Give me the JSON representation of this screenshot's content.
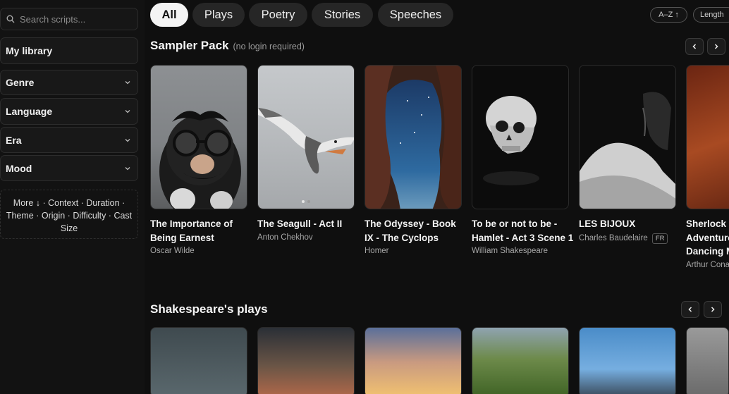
{
  "sidebar": {
    "search_placeholder": "Search scripts...",
    "my_library": "My library",
    "filters": [
      "Genre",
      "Language",
      "Era",
      "Mood"
    ],
    "more_label": "More ↓",
    "more_items": [
      "Context",
      "Duration",
      "Theme",
      "Origin",
      "Difficulty",
      "Cast",
      "Size"
    ]
  },
  "tabs": [
    {
      "label": "All",
      "active": true
    },
    {
      "label": "Plays",
      "active": false
    },
    {
      "label": "Poetry",
      "active": false
    },
    {
      "label": "Stories",
      "active": false
    },
    {
      "label": "Speeches",
      "active": false
    }
  ],
  "sort": {
    "az": "A–Z ↑",
    "length": "Length"
  },
  "sampler": {
    "title": "Sampler Pack",
    "subtitle": "(no login required)",
    "cards": [
      {
        "title": "The Importance of Being Earnest",
        "author": "Oscar Wilde",
        "badge": ""
      },
      {
        "title": "The Seagull - Act II",
        "author": "Anton Chekhov",
        "badge": ""
      },
      {
        "title": "The Odyssey - Book IX - The Cyclops",
        "author": "Homer",
        "badge": ""
      },
      {
        "title": "To be or not to be - Hamlet - Act 3 Scene 1",
        "author": "William Shakespeare",
        "badge": ""
      },
      {
        "title": "LES BIJOUX",
        "author": "Charles Baudelaire",
        "badge": "FR"
      },
      {
        "title": "Sherlock Holmes: The Adventure of the Dancing Men",
        "author": "Arthur Conan Doyle",
        "badge": ""
      }
    ]
  },
  "shakespeare": {
    "title": "Shakespeare's plays"
  },
  "colors": {
    "background": "#0f0f0f",
    "tab_active": "#f4f4f4",
    "tab_inactive": "#262626"
  }
}
